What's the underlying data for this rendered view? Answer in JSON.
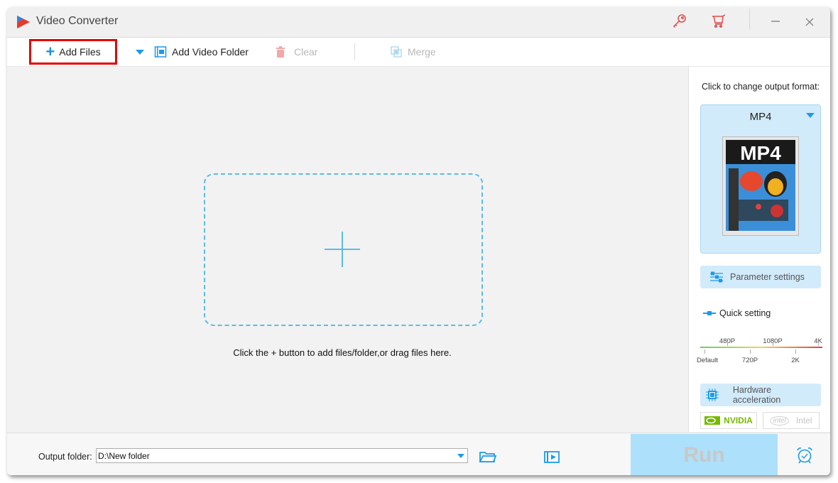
{
  "window": {
    "title": "Video Converter",
    "icons": [
      "key-icon",
      "cart-icon",
      "minimize-icon",
      "close-icon"
    ]
  },
  "toolbar": {
    "add_files": "Add Files",
    "add_video_folder": "Add Video Folder",
    "clear": "Clear",
    "merge": "Merge"
  },
  "main": {
    "hint": "Click the + button to add files/folder,or drag files here."
  },
  "sidebar": {
    "format_label": "Click to change output format:",
    "format_name": "MP4",
    "format_image_text": "MP4",
    "parameter_settings": "Parameter settings",
    "quick_setting": "Quick setting",
    "quality_levels_top": [
      "480P",
      "1080P",
      "4K"
    ],
    "quality_levels_bottom": [
      "Default",
      "720P",
      "2K"
    ],
    "hardware_acceleration": "Hardware acceleration",
    "nvidia": "NVIDIA",
    "intel": "Intel"
  },
  "bottom": {
    "output_label": "Output folder:",
    "output_value": "D:\\New folder",
    "run": "Run"
  },
  "colors": {
    "accent": "#1e9ae6",
    "highlight_border": "#e30000",
    "run_bg": "#ade0fa",
    "nvidia": "#76b900"
  }
}
